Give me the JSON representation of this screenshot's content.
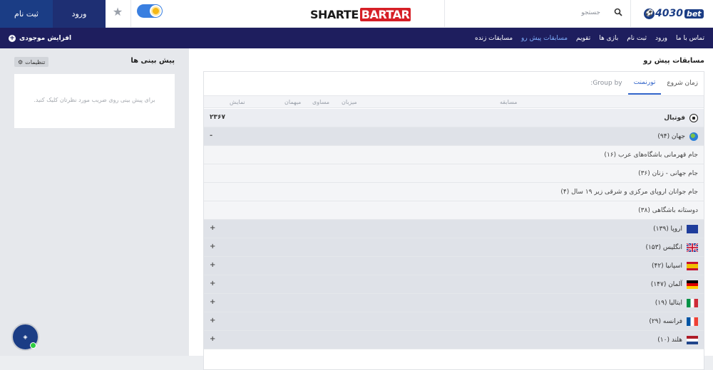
{
  "header": {
    "signup": "ثبت نام",
    "login": "ورود",
    "logo_part1": "SHARTE",
    "logo_part2": "BARTAR",
    "search_placeholder": "جستجو",
    "brand_num": "4030",
    "brand_suffix": "bet"
  },
  "nav": {
    "items": [
      "مسابقات زنده",
      "مسابقات پیش رو",
      "تقویم",
      "بازی ها",
      "ثبت نام",
      "ورود",
      "تماس با ما"
    ],
    "active_index": 1,
    "add_funds": "افزایش موجودی"
  },
  "predictions": {
    "title": "پیش بینی ها",
    "settings": "تنظیمات",
    "empty_text": "برای پیش بینی روی ضریب مورد نظرتان کلیک کنید."
  },
  "main": {
    "title": "مسابقات پیش رو",
    "group_by": "Group by:",
    "tabs": [
      "تورنمنت",
      "زمان شروع"
    ],
    "active_tab": 0,
    "columns": {
      "match": "مسابقه",
      "host": "میزبان",
      "draw": "مساوی",
      "guest": "میهمان",
      "show": "نمایش"
    },
    "sport": {
      "name": "فوتبال",
      "count": "۲۳۶۷"
    },
    "world": {
      "name": "جهان (۹۴)",
      "toggle": "-"
    },
    "leagues": [
      "جام قهرمانی باشگاه‌های عرب (۱۶)",
      "جام جهانی - زنان (۳۶)",
      "جام جوانان اروپای مرکزی و شرقی زیر ۱۹ سال (۴)",
      "دوستانه باشگاهی (۳۸)"
    ],
    "regions": [
      {
        "name": "اروپا (۱۳۹)",
        "flag": "eu",
        "toggle": "+"
      },
      {
        "name": "انگلیس (۱۵۳)",
        "flag": "gb",
        "toggle": "+"
      },
      {
        "name": "اسپانیا (۴۲)",
        "flag": "es",
        "toggle": "+"
      },
      {
        "name": "آلمان (۱۴۷)",
        "flag": "de",
        "toggle": "+"
      },
      {
        "name": "ایتالیا (۱۹)",
        "flag": "it",
        "toggle": "+"
      },
      {
        "name": "فرانسه (۲۹)",
        "flag": "fr",
        "toggle": "+"
      },
      {
        "name": "هلند (۱۰)",
        "flag": "nl",
        "toggle": "+"
      }
    ]
  },
  "colors": {
    "navy": "#1e1e5e",
    "blue": "#1b3d85",
    "accent": "#2f62c8",
    "logo_red": "#d61f26"
  }
}
